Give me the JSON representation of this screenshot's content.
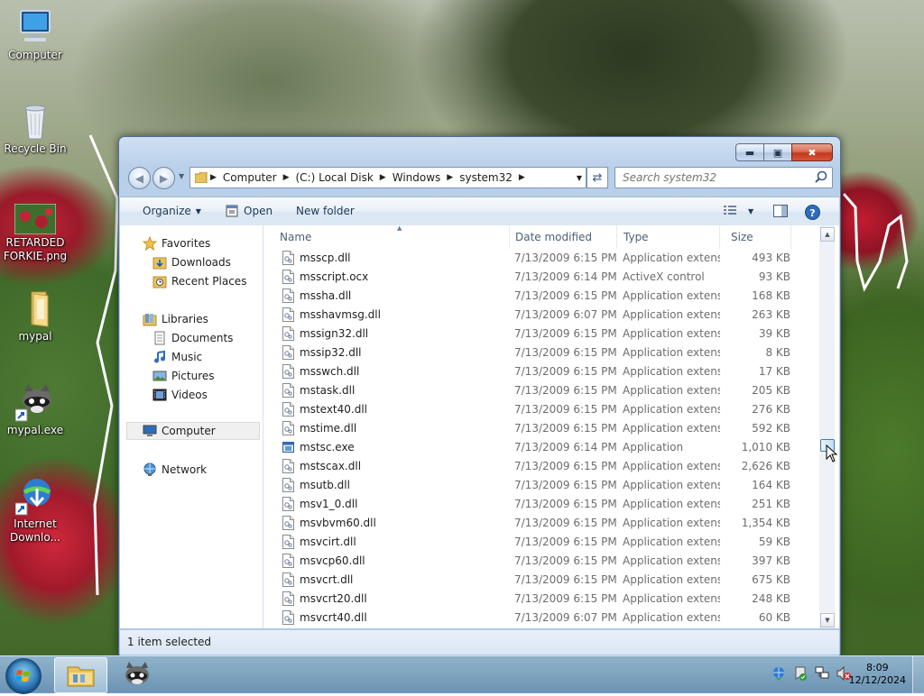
{
  "desktop": {
    "icons": [
      {
        "label": "Computer"
      },
      {
        "label": "Recycle Bin"
      },
      {
        "label_line1": "RETARDED",
        "label_line2": "FORKIE.png"
      },
      {
        "label": "mypal"
      },
      {
        "label": "mypal.exe"
      },
      {
        "label_line1": "Internet",
        "label_line2": "Downlo..."
      }
    ]
  },
  "window": {
    "breadcrumb": [
      "Computer",
      "(C:) Local Disk",
      "Windows",
      "system32"
    ],
    "search_placeholder": "Search system32",
    "toolbar": {
      "organize": "Organize",
      "open": "Open",
      "new_folder": "New folder"
    },
    "nav": {
      "favorites": "Favorites",
      "downloads": "Downloads",
      "recent_places": "Recent Places",
      "libraries": "Libraries",
      "documents": "Documents",
      "music": "Music",
      "pictures": "Pictures",
      "videos": "Videos",
      "computer": "Computer",
      "network": "Network"
    },
    "columns": {
      "name": "Name",
      "date": "Date modified",
      "type": "Type",
      "size": "Size"
    },
    "files": [
      {
        "name": "msscp.dll",
        "date": "7/13/2009 6:15 PM",
        "type": "Application extens...",
        "size": "493 KB"
      },
      {
        "name": "msscript.ocx",
        "date": "7/13/2009 6:14 PM",
        "type": "ActiveX control",
        "size": "93 KB"
      },
      {
        "name": "mssha.dll",
        "date": "7/13/2009 6:15 PM",
        "type": "Application extens...",
        "size": "168 KB"
      },
      {
        "name": "msshavmsg.dll",
        "date": "7/13/2009 6:07 PM",
        "type": "Application extens...",
        "size": "263 KB"
      },
      {
        "name": "mssign32.dll",
        "date": "7/13/2009 6:15 PM",
        "type": "Application extens...",
        "size": "39 KB"
      },
      {
        "name": "mssip32.dll",
        "date": "7/13/2009 6:15 PM",
        "type": "Application extens...",
        "size": "8 KB"
      },
      {
        "name": "msswch.dll",
        "date": "7/13/2009 6:15 PM",
        "type": "Application extens...",
        "size": "17 KB"
      },
      {
        "name": "mstask.dll",
        "date": "7/13/2009 6:15 PM",
        "type": "Application extens...",
        "size": "205 KB"
      },
      {
        "name": "mstext40.dll",
        "date": "7/13/2009 6:15 PM",
        "type": "Application extens...",
        "size": "276 KB"
      },
      {
        "name": "mstime.dll",
        "date": "7/13/2009 6:15 PM",
        "type": "Application extens...",
        "size": "592 KB"
      },
      {
        "name": "mstsc.exe",
        "date": "7/13/2009 6:14 PM",
        "type": "Application",
        "size": "1,010 KB"
      },
      {
        "name": "mstscax.dll",
        "date": "7/13/2009 6:15 PM",
        "type": "Application extens...",
        "size": "2,626 KB"
      },
      {
        "name": "msutb.dll",
        "date": "7/13/2009 6:15 PM",
        "type": "Application extens...",
        "size": "164 KB"
      },
      {
        "name": "msv1_0.dll",
        "date": "7/13/2009 6:15 PM",
        "type": "Application extens...",
        "size": "251 KB"
      },
      {
        "name": "msvbvm60.dll",
        "date": "7/13/2009 6:15 PM",
        "type": "Application extens...",
        "size": "1,354 KB"
      },
      {
        "name": "msvcirt.dll",
        "date": "7/13/2009 6:15 PM",
        "type": "Application extens...",
        "size": "59 KB"
      },
      {
        "name": "msvcp60.dll",
        "date": "7/13/2009 6:15 PM",
        "type": "Application extens...",
        "size": "397 KB"
      },
      {
        "name": "msvcrt.dll",
        "date": "7/13/2009 6:15 PM",
        "type": "Application extens...",
        "size": "675 KB"
      },
      {
        "name": "msvcrt20.dll",
        "date": "7/13/2009 6:15 PM",
        "type": "Application extens...",
        "size": "248 KB"
      },
      {
        "name": "msvcrt40.dll",
        "date": "7/13/2009 6:07 PM",
        "type": "Application extens...",
        "size": "60 KB"
      }
    ],
    "status": "1 item selected"
  },
  "taskbar": {
    "time": "8:09",
    "date": "12/12/2024"
  },
  "colors": {
    "window_frame": "#aac4e4",
    "close_button": "#c1391c",
    "selection": "#3c7fb1"
  }
}
